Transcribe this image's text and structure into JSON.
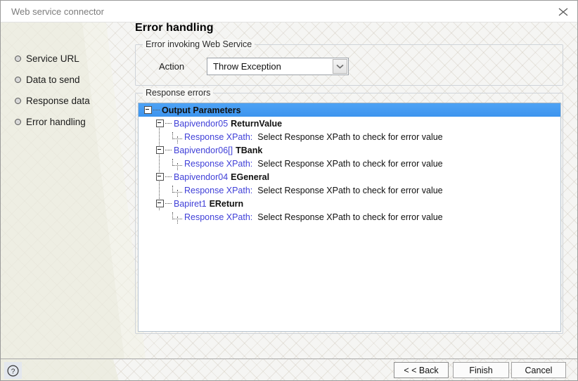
{
  "window": {
    "title": "Web service connector",
    "close_icon": "close-icon"
  },
  "sidebar": {
    "items": [
      {
        "label": "Service URL"
      },
      {
        "label": "Data to send"
      },
      {
        "label": "Response data"
      },
      {
        "label": "Error handling"
      }
    ]
  },
  "main": {
    "page_title": "Error handling",
    "invoking_group": {
      "legend": "Error invoking Web Service",
      "action_label": "Action",
      "action_value": "Throw Exception",
      "dropdown_icon": "chevron-down-icon"
    },
    "errors_group": {
      "legend": "Response errors",
      "tree": {
        "root": {
          "title": "Output Parameters",
          "selected": true
        },
        "nodes": [
          {
            "name": "Bapivendor05",
            "title": "ReturnValue",
            "xpath_key": "Response XPath:",
            "xpath_value": "Select Response XPath to check for error value"
          },
          {
            "name": "Bapivendor06[]",
            "title": "TBank",
            "xpath_key": "Response XPath:",
            "xpath_value": "Select Response XPath to check for error value"
          },
          {
            "name": "Bapivendor04",
            "title": "EGeneral",
            "xpath_key": "Response XPath:",
            "xpath_value": "Select Response XPath to check for error value"
          },
          {
            "name": "Bapiret1",
            "title": "EReturn",
            "xpath_key": "Response XPath:",
            "xpath_value": "Select Response XPath to check for error value"
          }
        ]
      }
    }
  },
  "footer": {
    "help_icon": "help-icon",
    "help_glyph": "?",
    "buttons": {
      "back": "< < Back",
      "finish": "Finish",
      "cancel": "Cancel"
    }
  },
  "colors": {
    "selection_blue": "#3d94ee",
    "node_name_blue": "#4040d8",
    "canvas": "#f5f5f3",
    "wedge_cream": "#ebebdd"
  }
}
